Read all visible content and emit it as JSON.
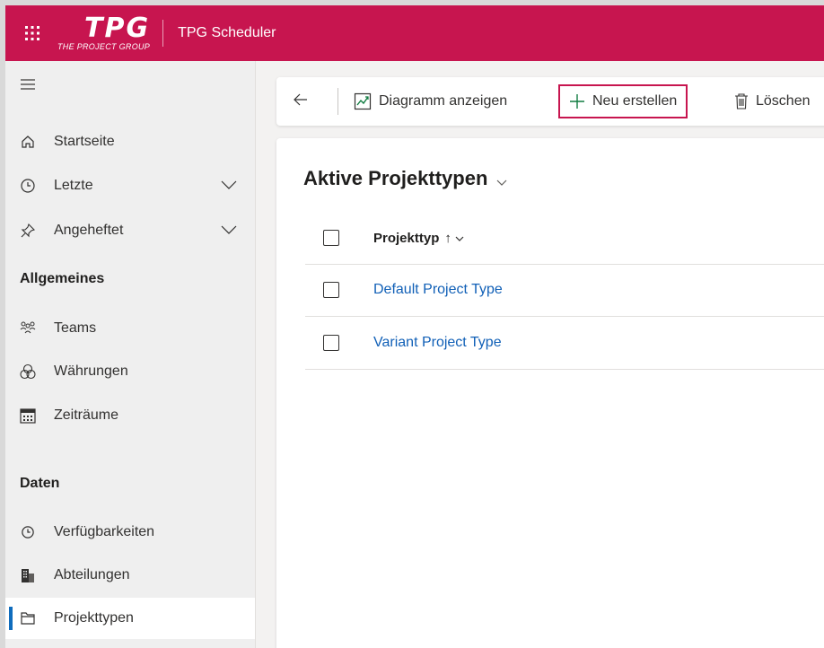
{
  "topbar": {
    "logo_text": "TPG",
    "logo_subtitle": "THE PROJECT GROUP",
    "app_title": "TPG Scheduler",
    "bg_color": "#c7154f"
  },
  "sidebar": {
    "items_top": [
      {
        "label": "Startseite",
        "icon": "home-icon"
      },
      {
        "label": "Letzte",
        "icon": "clock-icon",
        "expandable": true
      },
      {
        "label": "Angeheftet",
        "icon": "pin-icon",
        "expandable": true
      }
    ],
    "section_general": "Allgemeines",
    "items_general": [
      {
        "label": "Teams",
        "icon": "people-icon"
      },
      {
        "label": "Währungen",
        "icon": "coins-icon"
      },
      {
        "label": "Zeiträume",
        "icon": "calendar-icon"
      }
    ],
    "section_data": "Daten",
    "items_data": [
      {
        "label": "Verfügbarkeiten",
        "icon": "clock-icon"
      },
      {
        "label": "Abteilungen",
        "icon": "building-icon"
      },
      {
        "label": "Projekttypen",
        "icon": "folder-icon",
        "selected": true
      }
    ]
  },
  "toolbar": {
    "chart_label": "Diagramm anzeigen",
    "new_label": "Neu erstellen",
    "delete_label": "Löschen"
  },
  "view": {
    "title": "Aktive Projekttypen",
    "column_header": "Projekttyp",
    "sort_indicator": "↑",
    "rows": [
      "Default Project Type",
      "Variant Project Type"
    ]
  },
  "colors": {
    "accent": "#c7154f",
    "link": "#1160b7",
    "selection_bar": "#0f6cbd"
  }
}
